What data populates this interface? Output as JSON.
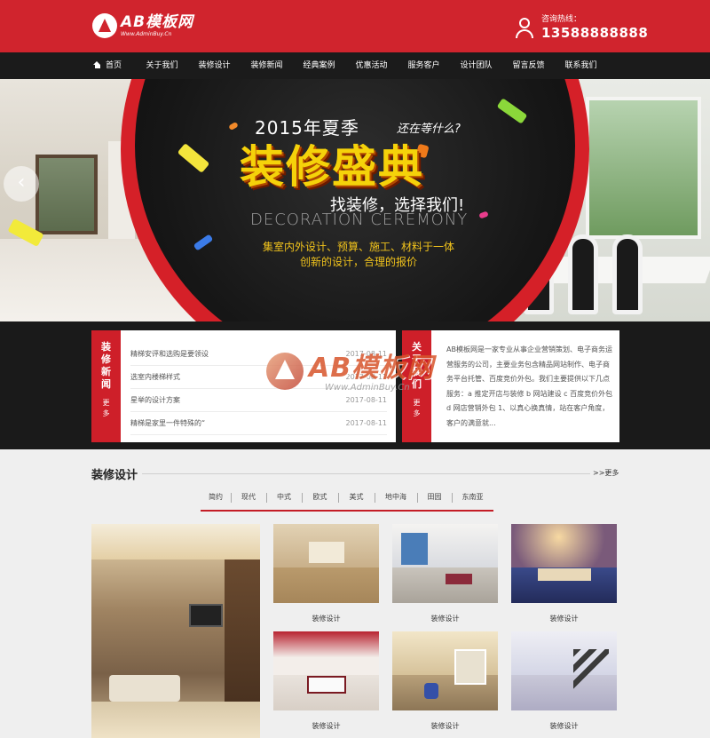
{
  "header": {
    "logo_title": "AB模板网",
    "logo_subtitle": "Www.AdminBuy.Cn",
    "hotline_label": "咨询热线：",
    "hotline_number": "13588888888"
  },
  "nav": {
    "items": [
      {
        "label": "首页"
      },
      {
        "label": "关于我们"
      },
      {
        "label": "装修设计"
      },
      {
        "label": "装修新闻"
      },
      {
        "label": "经典案例"
      },
      {
        "label": "优惠活动"
      },
      {
        "label": "服务客户"
      },
      {
        "label": "设计团队"
      },
      {
        "label": "留言反馈"
      },
      {
        "label": "联系我们"
      }
    ]
  },
  "banner": {
    "year_text": "2015年夏季",
    "question": "还在等什么?",
    "headline": "装修盛典",
    "slogan": "找装修，选择我们!",
    "english": "DECORATION CEREMONY",
    "line1": "集室内外设计、预算、施工、材料于一体",
    "line2": "创新的设计，合理的报价",
    "prev_arrow": "‹"
  },
  "news": {
    "title": "装修新闻",
    "more": "更多",
    "items": [
      {
        "title": "精梯安评和选购是要领设",
        "date": "2017-08-11"
      },
      {
        "title": "选室内楼梯样式",
        "date": "2017-08-11"
      },
      {
        "title": "星举的设计方案",
        "date": "2017-08-11"
      },
      {
        "title": "精梯是家里一件特殊的“",
        "date": "2017-08-11"
      }
    ]
  },
  "about": {
    "title": "关于我们",
    "more": "更多",
    "text": "AB模板网是一家专业从事企业营销策划、电子商务运营服务的公司，主要业务包含精品网站制作、电子商务平台托管、百度竞价外包。我们主要提供以下几点服务：a 推定开店与装修 b 网站建设 c 百度竞价外包 d 网店营销外包 1、以真心换真情，站在客户角度，客户的满意就..."
  },
  "watermark": {
    "title": "AB模板网",
    "subtitle": "Www.AdminBuy.Cn"
  },
  "design": {
    "title": "装修设计",
    "more": ">>更多",
    "categories": [
      {
        "label": "简约"
      },
      {
        "label": "现代"
      },
      {
        "label": "中式"
      },
      {
        "label": "欧式"
      },
      {
        "label": "美式"
      },
      {
        "label": "地中海"
      },
      {
        "label": "田园"
      },
      {
        "label": "东南亚"
      }
    ],
    "items": [
      {
        "caption": "装修设计"
      },
      {
        "caption": "装修设计"
      },
      {
        "caption": "装修设计"
      },
      {
        "caption": "装修设计"
      },
      {
        "caption": "装修设计"
      },
      {
        "caption": "装修设计"
      }
    ]
  },
  "colors": {
    "brand_red": "#d0242d",
    "nav_bg": "#1b1b1b",
    "accent_yellow": "#f5d20a"
  }
}
